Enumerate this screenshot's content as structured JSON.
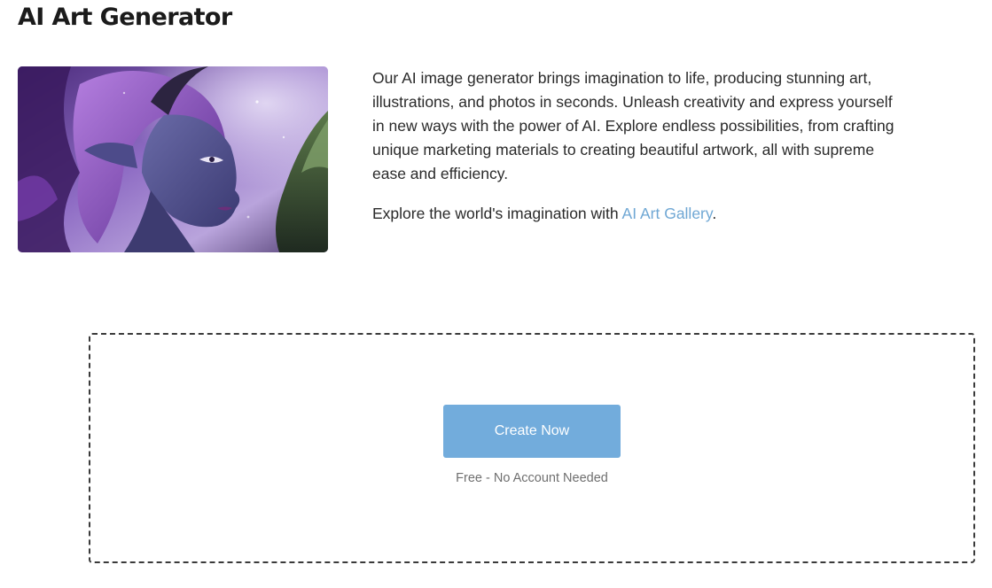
{
  "page": {
    "title": "AI Art Generator"
  },
  "hero": {
    "image_alt": "elf-fantasy-portrait"
  },
  "intro": {
    "paragraph1": "Our AI image generator brings imagination to life, producing stunning art, illustrations, and photos in seconds. Unleash creativity and express yourself in new ways with the power of AI. Explore endless possibilities, from crafting unique marketing materials to creating beautiful artwork, all with supreme ease and efficiency.",
    "paragraph2_prefix": "Explore the world's imagination with ",
    "gallery_link": "AI Art Gallery",
    "paragraph2_suffix": "."
  },
  "cta": {
    "button_label": "Create Now",
    "note": "Free - No Account Needed"
  },
  "colors": {
    "accent": "#72acdc",
    "link": "#6fa7d4",
    "text": "#2a2a2a",
    "muted": "#6f6f6f"
  }
}
